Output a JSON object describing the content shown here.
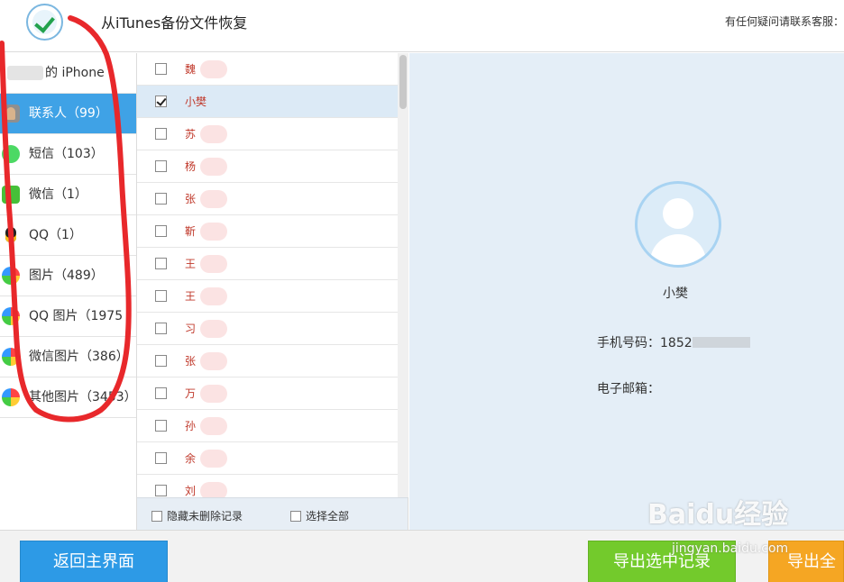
{
  "header": {
    "title": "从iTunes备份文件恢复",
    "support_text": "有任何疑问请联系客服："
  },
  "sidebar": {
    "device_label": "的 iPhone",
    "categories": [
      {
        "label": "联系人（99）",
        "icon": "contacts-icon",
        "active": true
      },
      {
        "label": "短信（103）",
        "icon": "messages-icon",
        "active": false
      },
      {
        "label": "微信（1）",
        "icon": "wechat-icon",
        "active": false
      },
      {
        "label": "QQ（1）",
        "icon": "qq-icon",
        "active": false
      },
      {
        "label": "图片（489）",
        "icon": "photos-icon",
        "active": false
      },
      {
        "label": "QQ 图片（1975",
        "icon": "qq-photos-icon",
        "active": false
      },
      {
        "label": "微信图片（386）",
        "icon": "wechat-photos-icon",
        "active": false
      },
      {
        "label": "其他图片（3453）",
        "icon": "other-photos-icon",
        "active": false
      }
    ]
  },
  "contacts": [
    {
      "name": "魏",
      "checked": false
    },
    {
      "name": "小樊",
      "checked": true
    },
    {
      "name": "苏",
      "checked": false
    },
    {
      "name": "杨",
      "checked": false
    },
    {
      "name": "张",
      "checked": false
    },
    {
      "name": "靳",
      "checked": false
    },
    {
      "name": "王",
      "checked": false
    },
    {
      "name": "王",
      "checked": false
    },
    {
      "name": "习",
      "checked": false
    },
    {
      "name": "张",
      "checked": false
    },
    {
      "name": "万",
      "checked": false
    },
    {
      "name": "孙",
      "checked": false
    },
    {
      "name": "余",
      "checked": false
    },
    {
      "name": "刘",
      "checked": false
    }
  ],
  "list_footer": {
    "hide_undeleted": "隐藏未删除记录",
    "select_all": "选择全部"
  },
  "detail": {
    "name": "小樊",
    "phone_label": "手机号码：",
    "phone_value": "1852",
    "email_label": "电子邮箱："
  },
  "buttons": {
    "back": "返回主界面",
    "export_selected": "导出选中记录",
    "export_all": "导出全"
  },
  "watermark": {
    "logo": "Baidu经验",
    "url": "jingyan.baidu.com"
  },
  "colors": {
    "accent_blue": "#3fa2e6",
    "export_green": "#73ca2c",
    "export_orange": "#f5a623",
    "annotation_red": "#e8282b"
  }
}
